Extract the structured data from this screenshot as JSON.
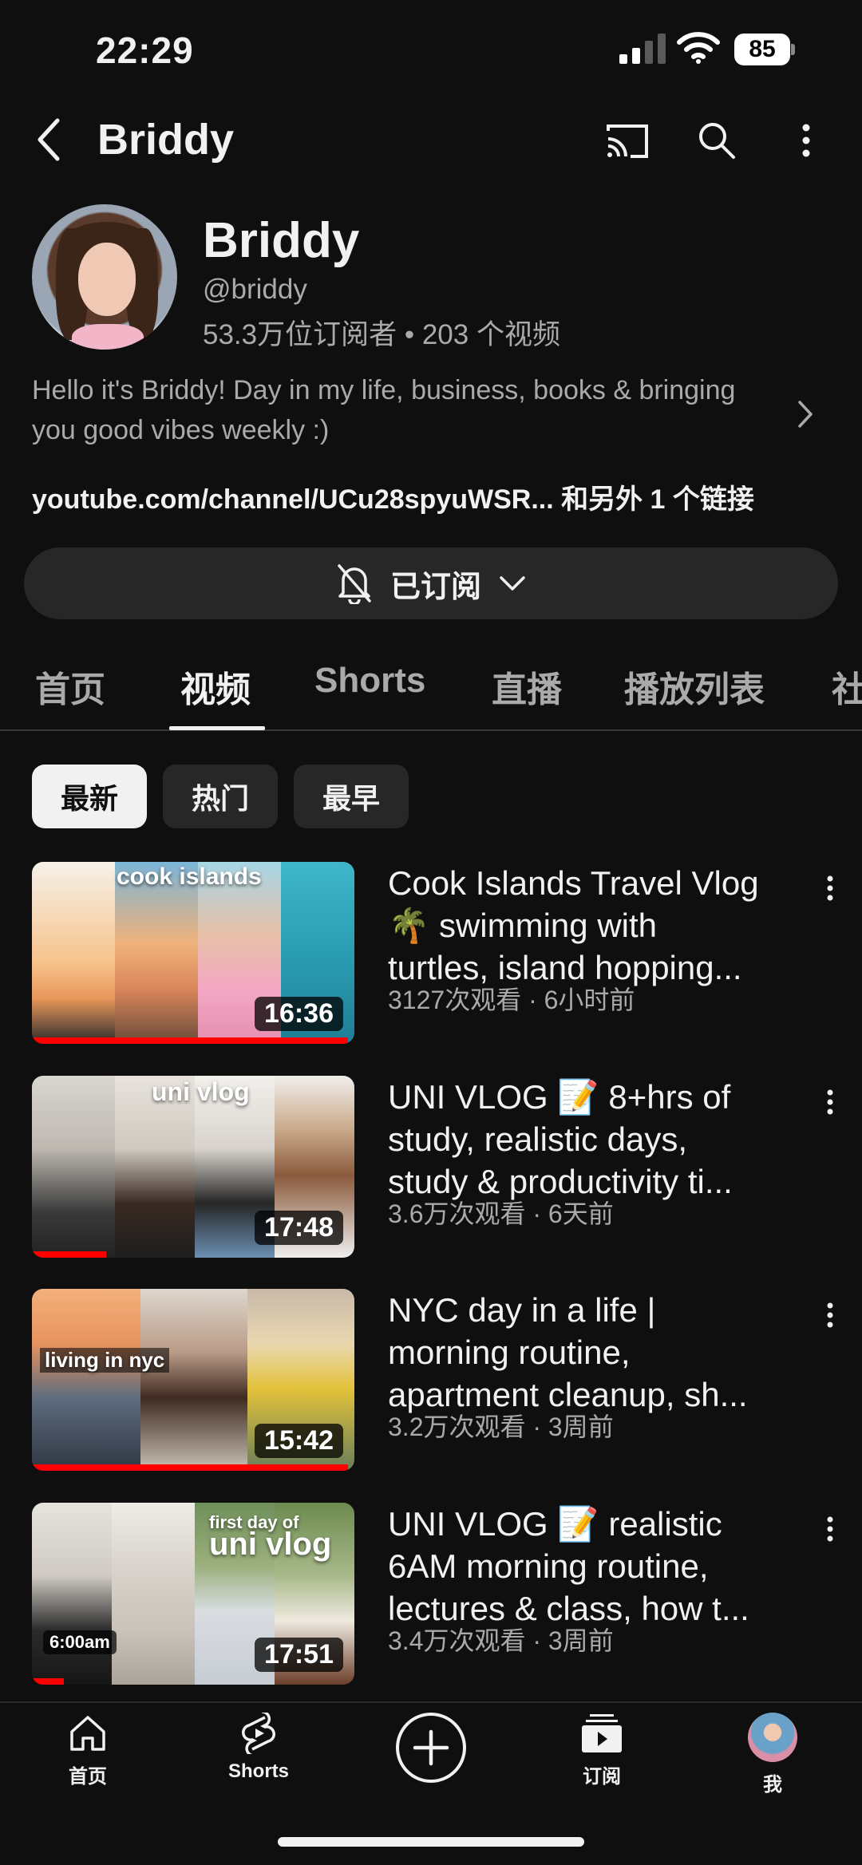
{
  "status": {
    "time": "22:29",
    "battery": "85"
  },
  "topbar": {
    "title": "Briddy"
  },
  "channel": {
    "name": "Briddy",
    "handle": "@briddy",
    "stats": "53.3万位订阅者 • 203 个视频",
    "description": "Hello it's Briddy! Day in my life, business, books & bringing you good vibes weekly :)",
    "links": "youtube.com/channel/UCu28spyuWSR... 和另外 1 个链接",
    "subscribe_label": "已订阅"
  },
  "tabs": [
    "首页",
    "视频",
    "Shorts",
    "直播",
    "播放列表",
    "社"
  ],
  "active_tab": "视频",
  "chips": [
    "最新",
    "热门",
    "最早"
  ],
  "videos": [
    {
      "title_lines": [
        "Cook Islands Travel Vlog",
        "🌴 swimming with",
        "turtles, island hopping..."
      ],
      "meta": "3127次观看 · 6小时前",
      "duration": "16:36",
      "thumb_text": "cook islands",
      "progress": 0.98
    },
    {
      "title_lines": [
        "UNI VLOG 📝 8+hrs of",
        "study, realistic days,",
        "study & productivity ti..."
      ],
      "meta": "3.6万次观看 · 6天前",
      "duration": "17:48",
      "thumb_text": "uni vlog",
      "progress": 0.23
    },
    {
      "title_lines": [
        "NYC day in a life |",
        "morning routine,",
        "apartment cleanup, sh..."
      ],
      "meta": "3.2万次观看 · 3周前",
      "duration": "15:42",
      "thumb_text": "living in nyc",
      "progress": 0.98
    },
    {
      "title_lines": [
        "UNI VLOG 📝 realistic",
        "6AM morning routine,",
        "lectures & class, how t..."
      ],
      "meta": "3.4万次观看 · 3周前",
      "duration": "17:51",
      "thumb_text": "uni vlog",
      "thumb_subtext": "first day of",
      "thumb_badge": "6:00am",
      "progress": 0.1
    }
  ],
  "nav": {
    "home": "首页",
    "shorts": "Shorts",
    "subscriptions": "订阅",
    "me": "我"
  },
  "colors": {
    "background": "#0f0f0f",
    "accent": "#ff0000",
    "chip": "#272727"
  }
}
